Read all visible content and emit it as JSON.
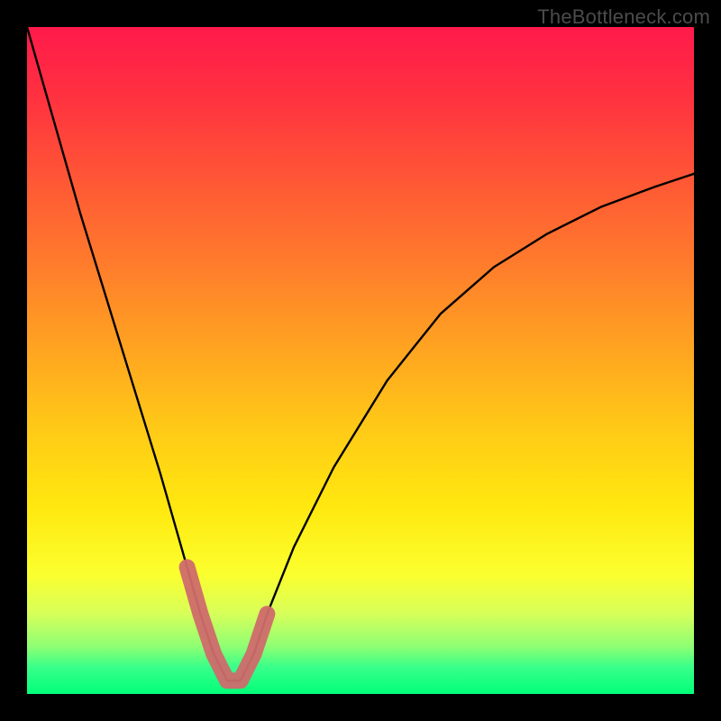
{
  "watermark": "TheBottleneck.com",
  "chart_data": {
    "type": "line",
    "title": "",
    "xlabel": "",
    "ylabel": "",
    "xlim": [
      0,
      100
    ],
    "ylim": [
      0,
      100
    ],
    "note": "Notional V-shaped bottleneck curve. Background gradient encodes severity (top=red=high, bottom=green=low). The black line is the mismatch curve reaching ~0 near x≈30; a salmon thick segment highlights the minimum region (optimal balance).",
    "series": [
      {
        "name": "bottleneck-curve",
        "color": "#000000",
        "x": [
          0,
          4,
          8,
          12,
          16,
          20,
          24,
          26,
          28,
          30,
          32,
          34,
          36,
          40,
          46,
          54,
          62,
          70,
          78,
          86,
          94,
          100
        ],
        "y": [
          100,
          86,
          72,
          59,
          46,
          33,
          19,
          12,
          6,
          2,
          2,
          6,
          12,
          22,
          34,
          47,
          57,
          64,
          69,
          73,
          76,
          78
        ]
      },
      {
        "name": "optimal-region-highlight",
        "color": "#cf6b6b",
        "x": [
          24,
          26,
          28,
          30,
          32,
          34,
          36
        ],
        "y": [
          19,
          12,
          6,
          2,
          2,
          6,
          12
        ]
      }
    ],
    "gradient_stops": [
      {
        "pct": 0,
        "color": "#ff1a4b"
      },
      {
        "pct": 10,
        "color": "#ff3040"
      },
      {
        "pct": 22,
        "color": "#ff5436"
      },
      {
        "pct": 35,
        "color": "#ff7a2c"
      },
      {
        "pct": 48,
        "color": "#ffa321"
      },
      {
        "pct": 60,
        "color": "#ffc917"
      },
      {
        "pct": 72,
        "color": "#ffe80f"
      },
      {
        "pct": 82,
        "color": "#fbff2e"
      },
      {
        "pct": 88,
        "color": "#d7ff5a"
      },
      {
        "pct": 93,
        "color": "#8cff74"
      },
      {
        "pct": 96,
        "color": "#38ff8a"
      },
      {
        "pct": 100,
        "color": "#02ff7a"
      }
    ]
  }
}
